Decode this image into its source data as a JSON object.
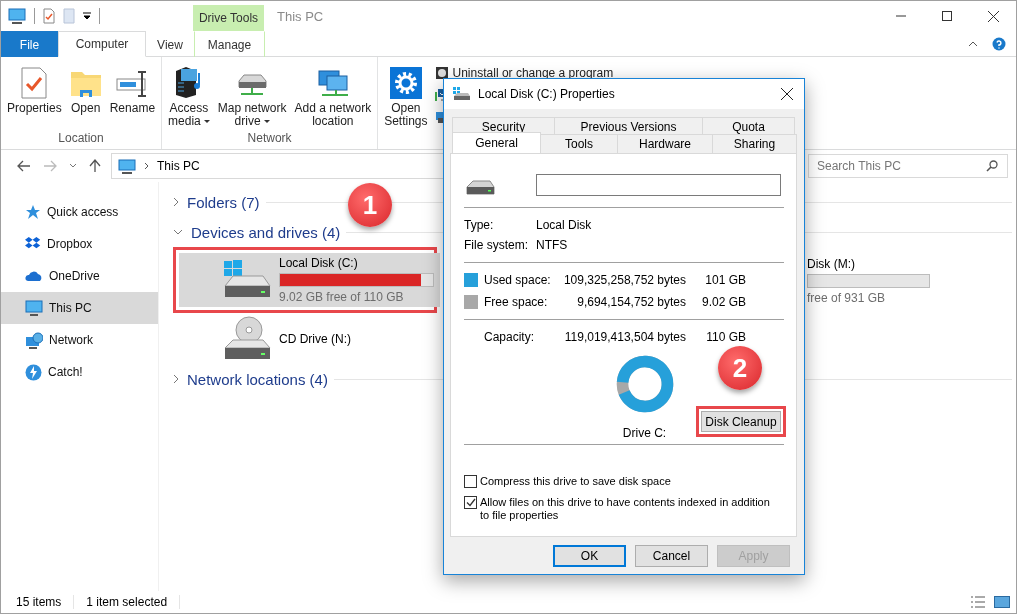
{
  "title_bar": {
    "context_tab": "Drive Tools",
    "title": "This PC"
  },
  "ribbon_tabs": [
    {
      "label": "File",
      "kind": "file",
      "selected": false
    },
    {
      "label": "Computer",
      "kind": "tab",
      "selected": true
    },
    {
      "label": "View",
      "kind": "tab",
      "selected": false
    },
    {
      "label": "Manage",
      "kind": "context",
      "selected": false
    }
  ],
  "ribbon_groups": [
    {
      "label": "Location",
      "buttons": [
        {
          "kind": "properties",
          "label": "Properties",
          "dropdown": false
        },
        {
          "kind": "open",
          "label": "Open",
          "dropdown": false
        },
        {
          "kind": "rename",
          "label": "Rename",
          "dropdown": false
        }
      ]
    },
    {
      "label": "Network",
      "buttons": [
        {
          "kind": "media",
          "label": "Access\nmedia",
          "dropdown": true
        },
        {
          "kind": "map-drive",
          "label": "Map network\ndrive",
          "dropdown": true
        },
        {
          "kind": "net-location",
          "label": "Add a network\nlocation",
          "dropdown": false
        }
      ]
    },
    {
      "buttons": [
        {
          "kind": "settings",
          "label": "Open\nSettings",
          "dropdown": false
        }
      ],
      "small_buttons": [
        {
          "kind": "uninstall",
          "label": "Uninstall or change a program"
        },
        {
          "kind": "system"
        },
        {
          "kind": "manage"
        }
      ]
    }
  ],
  "address": {
    "location": "This PC"
  },
  "search": {
    "placeholder": "Search This PC"
  },
  "sidebar": [
    {
      "kind": "star",
      "label": "Quick access",
      "selected": false
    },
    {
      "kind": "dropbox",
      "label": "Dropbox",
      "selected": false
    },
    {
      "kind": "cloud",
      "label": "OneDrive",
      "selected": false
    },
    {
      "kind": "pc",
      "label": "This PC",
      "selected": true
    },
    {
      "kind": "network",
      "label": "Network",
      "selected": false
    },
    {
      "kind": "bolt",
      "label": "Catch!",
      "selected": false
    }
  ],
  "sections": [
    {
      "label": "Folders (7)",
      "expanded": false
    },
    {
      "label": "Devices and drives (4)",
      "expanded": true,
      "drives": [
        {
          "kind": "hdd",
          "name": "Local Disk (C:)",
          "level": 0.92,
          "free": "9.02 GB free of 110 GB",
          "selected": true,
          "highlighted": true
        },
        {
          "kind": "cd",
          "name": "CD Drive (N:)",
          "selected": false,
          "highlighted": false
        },
        {
          "kind": "partial",
          "name": "Disk (M:)",
          "free": "free of 931 GB",
          "selected": false,
          "highlighted": false
        }
      ]
    },
    {
      "label": "Network locations (4)",
      "expanded": false
    }
  ],
  "status_bar": [
    "15 items",
    "1 item selected"
  ],
  "dialog": {
    "title": "Local Disk (C:) Properties",
    "tabs_back": [
      {
        "label": "Security",
        "selected": false
      },
      {
        "label": "Previous Versions",
        "selected": false
      },
      {
        "label": "Quota",
        "selected": false
      }
    ],
    "tabs_front": [
      {
        "label": "General",
        "selected": true
      },
      {
        "label": "Tools",
        "selected": false
      },
      {
        "label": "Hardware",
        "selected": false
      },
      {
        "label": "Sharing",
        "selected": false
      }
    ],
    "properties": [
      {
        "label": "Type:",
        "value": "Local Disk"
      },
      {
        "label": "File system:",
        "value": "NTFS"
      }
    ],
    "space": [
      {
        "label": "Used space:",
        "bytes": "109,325,258,752 bytes",
        "size": "101 GB",
        "color": "#26a0da"
      },
      {
        "label": "Free space:",
        "bytes": "9,694,154,752 bytes",
        "size": "9.02 GB",
        "color": "#a8a8a8"
      }
    ],
    "capacity": {
      "label": "Capacity:",
      "bytes": "119,019,413,504 bytes",
      "size": "110 GB"
    },
    "donut": {
      "level": 0.92,
      "caption": "Drive C:"
    },
    "cleanup_button": {
      "label": "Disk Cleanup",
      "highlighted": true
    },
    "options": [
      {
        "label": "Compress this drive to save disk space",
        "checked": false
      },
      {
        "label": "Allow files on this drive to have contents indexed in addition to file properties",
        "checked": true
      }
    ],
    "buttons": [
      {
        "label": "OK",
        "kind": "default",
        "disabled": false
      },
      {
        "label": "Cancel",
        "kind": "normal",
        "disabled": false
      },
      {
        "label": "Apply",
        "kind": "normal",
        "disabled": true
      }
    ]
  },
  "annotations": [
    {
      "label": "1"
    },
    {
      "label": "2"
    }
  ]
}
